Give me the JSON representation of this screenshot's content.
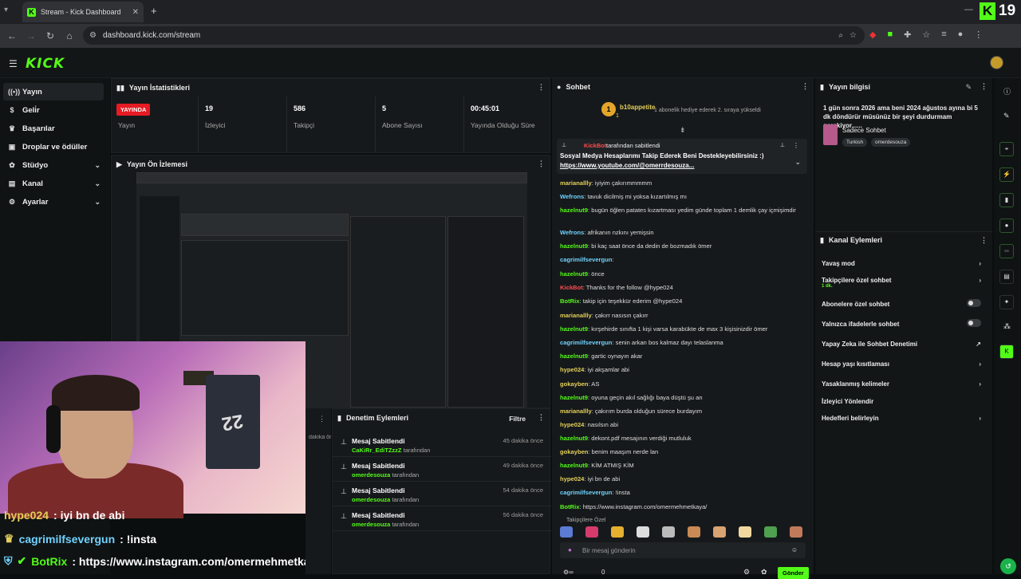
{
  "browser": {
    "tab_title": "Stream - Kick Dashboard",
    "url": "dashboard.kick.com/stream",
    "kick_badge_num": "19"
  },
  "header": {
    "logo": "KICK"
  },
  "sidebar": {
    "items": [
      {
        "label": "Yayın",
        "icon": "broadcast-icon",
        "active": true
      },
      {
        "label": "Geli̇r",
        "icon": "dollar-icon"
      },
      {
        "label": "Başarılar",
        "icon": "trophy-icon"
      },
      {
        "label": "Droplar ve ödüller",
        "icon": "gift-icon"
      },
      {
        "label": "Stüdyo",
        "icon": "palette-icon",
        "chev": true
      },
      {
        "label": "Kanal",
        "icon": "channel-icon",
        "chev": true
      },
      {
        "label": "Ayarlar",
        "icon": "gear-icon",
        "chev": true
      }
    ]
  },
  "stats": {
    "title": "Yayın İstatistikleri",
    "live_badge": "YAYINDA",
    "cells": [
      {
        "value": "",
        "label": "Yayın"
      },
      {
        "value": "19",
        "label": "İzleyici"
      },
      {
        "value": "586",
        "label": "Takipçi"
      },
      {
        "value": "5",
        "label": "Abone Sayısı"
      },
      {
        "value": "00:45:01",
        "label": "Yayında Olduğu Süre"
      }
    ]
  },
  "preview": {
    "title": "Yayın Ön İzlemesi"
  },
  "overlay": [
    {
      "user": "hype024",
      "text": ": iyi bn de abi"
    },
    {
      "user": "cagrimilfsevergun",
      "text": ": !insta"
    },
    {
      "user": "BotRix",
      "text": ": https://www.instagram.com/omermehmetkaya/"
    }
  ],
  "moderation": {
    "title": "Denetim Eylemleri",
    "filter": "Filtre",
    "partial_time": "dakika önce",
    "items": [
      {
        "action": "Mesaj Sabitlendi",
        "user": "CaKiRr_EdiTZzzZ",
        "suffix": "tarafından",
        "time": "45 dakika önce"
      },
      {
        "action": "Mesaj Sabitlendi",
        "user": "omerdesouza",
        "suffix": "tarafından",
        "time": "49 dakika önce"
      },
      {
        "action": "Mesaj Sabitlendi",
        "user": "omerdesouza",
        "suffix": "tarafından",
        "time": "54 dakika önce"
      },
      {
        "action": "Mesaj Sabitlendi",
        "user": "omerdesouza",
        "suffix": "tarafından",
        "time": "56 dakika önce"
      }
    ]
  },
  "chat": {
    "title": "Sohbet",
    "gifter": {
      "name": "b10appetite",
      "count": "1",
      "text": "1 abonelik hediye ederek 2. sıraya yükseldi"
    },
    "pinned": {
      "by_user": "KickBot",
      "by_text": "tarafından sabitlendi",
      "text": "Sosyal Medya Hesaplarımı Takip Ederek Beni Destekleyebilirsiniz :)",
      "link": "https://www.youtube.com/@omerrdesouza..."
    },
    "messages": [
      {
        "user": "marianallly",
        "color": "#e3cf5a",
        "text": ": iyiyim çakırımmmmm"
      },
      {
        "user": "Wefrons",
        "color": "#6fd3ff",
        "text": ": tavuk dicilmiş mi yoksa kızartılmış mı"
      },
      {
        "user": "hazelnut9",
        "color": "#53fc18",
        "text": ": bugün öğlen patates kızartması yedim günde toplam 1 demlik çay içmişimdir"
      },
      {
        "user": "Wefrons",
        "color": "#6fd3ff",
        "text": ": afrikanın nzkını yemişsin"
      },
      {
        "user": "hazelnut9",
        "color": "#53fc18",
        "text": ": bi kaç saat önce da dedin de bozmadık ömer"
      },
      {
        "user": "cagrimilfsevergun",
        "color": "#6fd3ff",
        "text": ":"
      },
      {
        "user": "hazelnut9",
        "color": "#53fc18",
        "text": ": önce"
      },
      {
        "user": "KickBot",
        "color": "#ff4b4b",
        "text": ": Thanks for the follow @hype024"
      },
      {
        "user": "BotRix",
        "color": "#53fc18",
        "text": ": takip için teşekkür ederim @hype024"
      },
      {
        "user": "marianallly",
        "color": "#e3cf5a",
        "text": ": çakırr nasısın çakırr"
      },
      {
        "user": "hazelnut9",
        "color": "#53fc18",
        "text": ": kırşehirde sınıfta 1 kişi varsa karabükte de max 3 kişisinizdir ömer"
      },
      {
        "user": "cagrimilfsevergun",
        "color": "#6fd3ff",
        "text": ": senin arkan bos kalmaz dayı telaslanma"
      },
      {
        "user": "hazelnut9",
        "color": "#53fc18",
        "text": ": gartic oynayın akar"
      },
      {
        "user": "hype024",
        "color": "#e3cf5a",
        "text": ": iyi akşamlar abi"
      },
      {
        "user": "gokayben",
        "color": "#e3cf5a",
        "text": ": AS"
      },
      {
        "user": "hazelnut9",
        "color": "#53fc18",
        "text": ": oyuna geçin akıl sağlığı baya düştü şu an"
      },
      {
        "user": "marianallly",
        "color": "#e3cf5a",
        "text": ": çakırım burda olduğun sürece burdayım"
      },
      {
        "user": "hype024",
        "color": "#e3cf5a",
        "text": ": nasılsın abi"
      },
      {
        "user": "hazelnut9",
        "color": "#53fc18",
        "text": ": dekont.pdf mesajının verdiği mutluluk"
      },
      {
        "user": "gokayben",
        "color": "#e3cf5a",
        "text": ": benim maaşım nerde lan"
      },
      {
        "user": "hazelnut9",
        "color": "#53fc18",
        "text": ": KİM ATMIŞ KİM"
      },
      {
        "user": "hype024",
        "color": "#e3cf5a",
        "text": ": iyi bn de abi"
      },
      {
        "user": "cagrimilfsevergun",
        "color": "#6fd3ff",
        "text": ": !insta"
      },
      {
        "user": "BotRix",
        "color": "#53fc18",
        "text": ": https://www.instagram.com/omermehmetkaya/"
      }
    ],
    "follower_label": "Takipçilere Özel",
    "input_placeholder": "Bir mesaj gönderin",
    "send_label": "Gönder",
    "counter": "0"
  },
  "stream_info": {
    "title": "Yayın bilgisi",
    "text": "1 gün sonra 2026 ama beni 2024 ağustos ayına bi 5 dk döndürür müsünüz bir şeyi durdurmam gerekiyor......",
    "category": "Sadece Sohbet",
    "tags": [
      "Turkish",
      "omerdesouza"
    ]
  },
  "channel_actions": {
    "title": "Kanal Eylemleri",
    "items": [
      {
        "label": "Yavaş mod",
        "type": "chev"
      },
      {
        "label": "Takipçilere özel sohbet",
        "sub": "1 dk.",
        "type": "chev"
      },
      {
        "label": "Abonelere özel sohbet",
        "type": "toggle"
      },
      {
        "label": "Yalnızca ifadelerle sohbet",
        "type": "toggle"
      },
      {
        "label": "Yapay Zeka ile Sohbet Denetimi",
        "type": "ext"
      },
      {
        "label": "Hesap yaşı kısıtlaması",
        "type": "chev"
      },
      {
        "label": "Yasaklanmış kelimeler",
        "type": "chev"
      },
      {
        "label": "İzleyici Yönlendir",
        "type": "none"
      },
      {
        "label": "Hedefleri belirleyin",
        "type": "chev"
      }
    ]
  },
  "colors": {
    "accent": "#53fc18",
    "live": "#e61b23",
    "bg": "#0b0e0f"
  }
}
